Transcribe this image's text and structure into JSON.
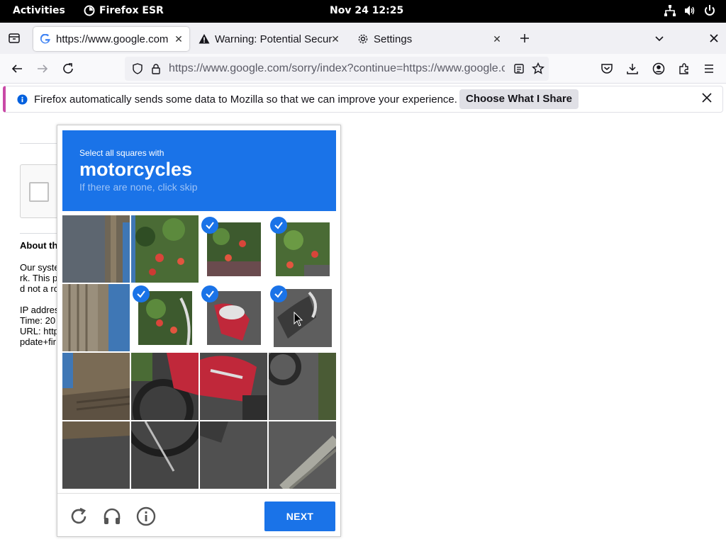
{
  "topbar": {
    "activities": "Activities",
    "app_name": "Firefox ESR",
    "clock": "Nov 24  12:25"
  },
  "tabs": [
    {
      "title": "https://www.google.com",
      "icon": "google-g-icon",
      "active": true
    },
    {
      "title": "Warning: Potential Securi",
      "icon": "warning-icon",
      "active": false
    },
    {
      "title": "Settings",
      "icon": "gear-icon",
      "active": false
    }
  ],
  "navbar": {
    "url": "https://www.google.com/sorry/index?continue=https://www.google.c"
  },
  "notification": {
    "message": "Firefox automatically sends some data to Mozilla so that we can improve your experience.",
    "button_label": "Choose What I Share"
  },
  "page": {
    "about_heading": "About th",
    "line1": "Our syste",
    "line2": "rk. This p",
    "line3": "d not a ro",
    "ip": "IP addres",
    "time": "Time: 20",
    "url": "URL: http",
    "update": "pdate+fir"
  },
  "captcha": {
    "instruction_small": "Select all squares with",
    "target": "motorcycles",
    "hint": "If there are none, click skip",
    "next_label": "NEXT",
    "accent": "#1a73e8",
    "selected_tiles": [
      2,
      3,
      5,
      6,
      7
    ]
  }
}
